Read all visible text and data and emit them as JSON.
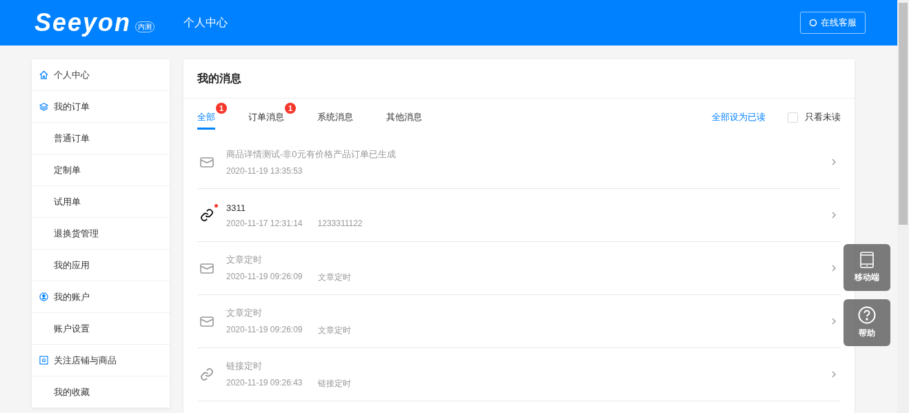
{
  "header": {
    "logo": "Seeyon",
    "logo_badge": "内测",
    "title": "个人中心",
    "service_button": "在线客服"
  },
  "sidebar": {
    "items": [
      {
        "label": "个人中心",
        "kind": "home",
        "selected": false
      },
      {
        "label": "我的订单",
        "kind": "layers",
        "selected": false
      },
      {
        "label": "普通订单",
        "selected": false
      },
      {
        "label": "定制单",
        "selected": false
      },
      {
        "label": "试用单",
        "selected": false
      },
      {
        "label": "退换货管理",
        "selected": false
      },
      {
        "label": "我的应用",
        "selected": false
      },
      {
        "label": "我的账户",
        "kind": "user",
        "selected": false
      },
      {
        "label": "账户设置",
        "selected": false
      },
      {
        "label": "关注店铺与商品",
        "kind": "store",
        "selected": false
      },
      {
        "label": "我的收藏",
        "selected": false
      }
    ]
  },
  "panel": {
    "title": "我的消息",
    "tabs": [
      {
        "label": "全部",
        "badge": "1",
        "selected": true
      },
      {
        "label": "订单消息",
        "badge": "1",
        "selected": false
      },
      {
        "label": "系统消息",
        "selected": false
      },
      {
        "label": "其他消息",
        "selected": false
      }
    ],
    "mark_all_read": "全部设为已读",
    "unread_only": {
      "label": "只看未读",
      "checked": false
    },
    "messages": [
      {
        "kind": "mail",
        "title": "商品详情测试-非0元有价格产品订单已生成",
        "time": "2020-11-19 13:35:53",
        "unread": false
      },
      {
        "kind": "link",
        "title": "3311",
        "time": "2020-11-17 12:31:14",
        "detail": "1233311122",
        "unread": true
      },
      {
        "kind": "mail",
        "title": "文章定时",
        "time": "2020-11-19 09:26:09",
        "detail": "文章定时",
        "unread": false
      },
      {
        "kind": "mail",
        "title": "文章定时",
        "time": "2020-11-19 09:26:09",
        "detail": "文章定时",
        "unread": false
      },
      {
        "kind": "link",
        "title": "链接定时",
        "time": "2020-11-19 09:26:43",
        "detail": "链接定时",
        "unread": false
      }
    ]
  },
  "float_buttons": [
    {
      "kind": "mobile",
      "label": "移动端"
    },
    {
      "kind": "help",
      "label": "帮助"
    }
  ]
}
